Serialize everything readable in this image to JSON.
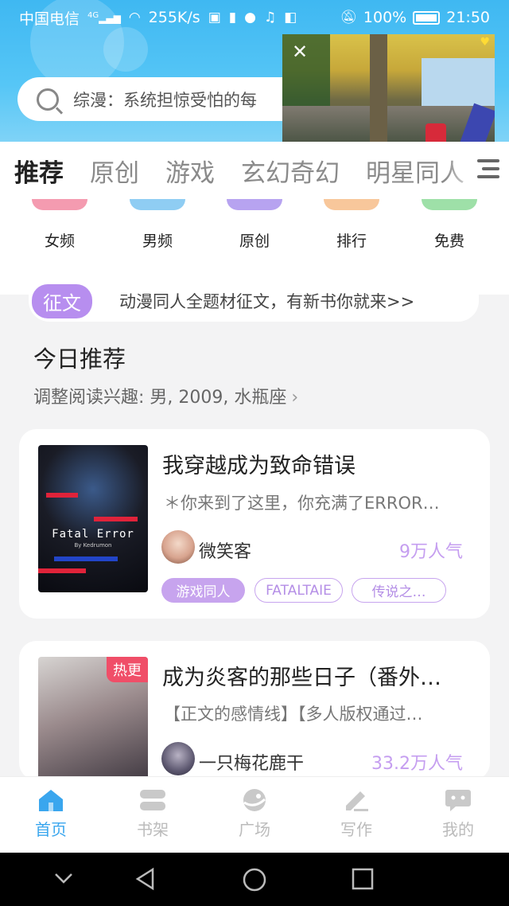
{
  "status_bar": {
    "carrier": "中国电信",
    "network": "4G",
    "speed": "255K/s",
    "battery": "100%",
    "time": "21:50"
  },
  "search": {
    "placeholder": "综漫：系统担惊受怕的每"
  },
  "tabs": [
    {
      "label": "推荐",
      "active": true
    },
    {
      "label": "原创",
      "active": false
    },
    {
      "label": "游戏",
      "active": false
    },
    {
      "label": "玄幻奇幻",
      "active": false
    },
    {
      "label": "明星同人",
      "active": false
    }
  ],
  "quick_entries": [
    {
      "label": "女频",
      "color": "#f49bb0"
    },
    {
      "label": "男频",
      "color": "#8fcdf3"
    },
    {
      "label": "原创",
      "color": "#b7a3f0"
    },
    {
      "label": "排行",
      "color": "#f8c79b"
    },
    {
      "label": "免费",
      "color": "#9ee0a8"
    }
  ],
  "notice": {
    "badge": "征文",
    "text": "动漫同人全题材征文，有新书你就来>>"
  },
  "section": {
    "title": "今日推荐",
    "subtitle": "调整阅读兴趣: 男, 2009, 水瓶座"
  },
  "books": [
    {
      "title": "我穿越成为致命错误",
      "desc": "＊你来到了这里，你充满了ERROR…",
      "author": "微笑客",
      "heat": "9万人气",
      "cover_title": "Fatal Error",
      "cover_sub": "By Kedrumon",
      "tags": [
        "游戏同人",
        "FATALTAIE",
        "传说之…"
      ]
    },
    {
      "title": "成为炎客的那些日子（番外…",
      "desc": "【正文的感情线】【多人版权通过…",
      "author": "一只梅花鹿干",
      "heat": "33.2万人气",
      "cover_badge": "热更"
    }
  ],
  "bottom_nav": [
    {
      "label": "首页",
      "icon": "home-icon",
      "active": true
    },
    {
      "label": "书架",
      "icon": "bookshelf-icon",
      "active": false
    },
    {
      "label": "广场",
      "icon": "plaza-icon",
      "active": false
    },
    {
      "label": "写作",
      "icon": "write-icon",
      "active": false
    },
    {
      "label": "我的",
      "icon": "profile-icon",
      "active": false
    }
  ],
  "colors": {
    "header": "#4dbff4",
    "accent_purple": "#c7a4ee",
    "nav_active": "#3aa6ee"
  }
}
